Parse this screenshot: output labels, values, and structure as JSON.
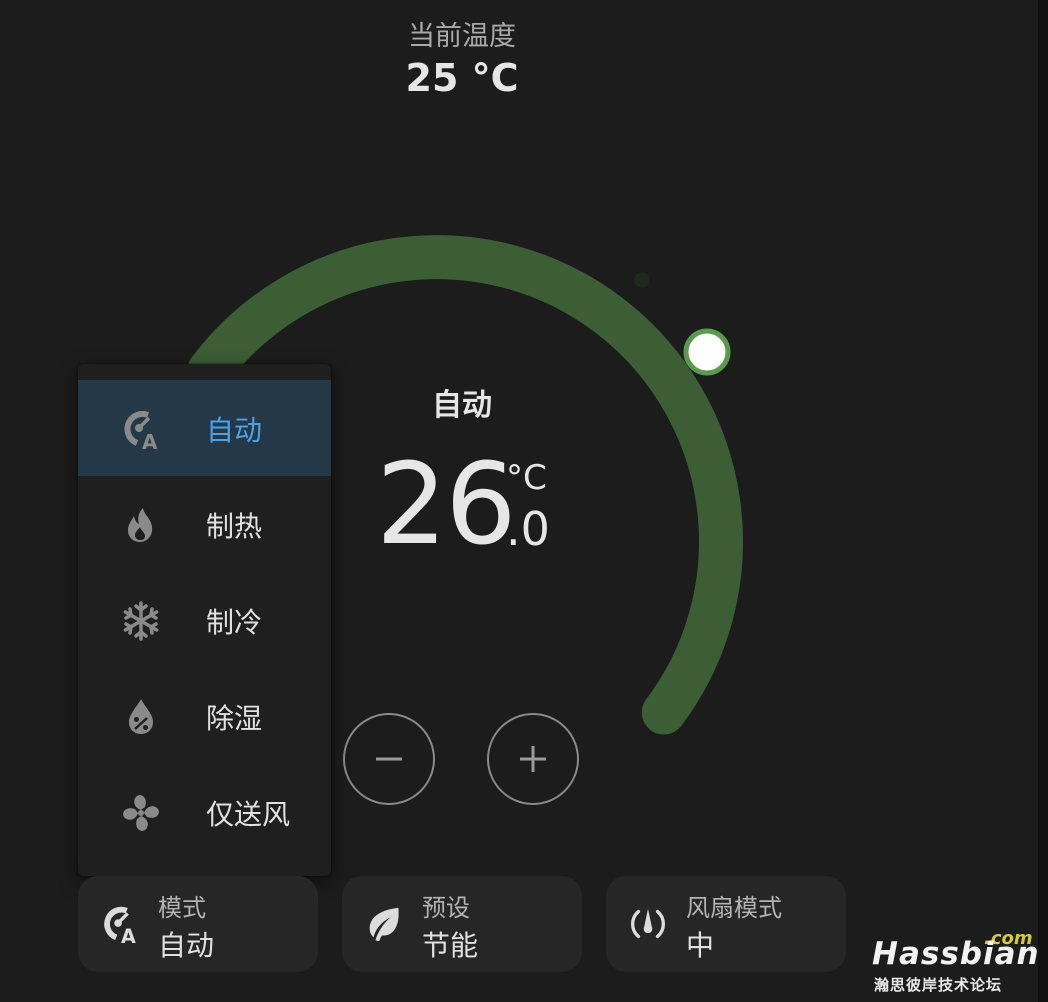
{
  "current": {
    "label": "当前温度",
    "value": "25 °C"
  },
  "dial": {
    "arc_color": "#3b5e35",
    "handle_ring_color": "#5a9a4c",
    "handle_fill_color": "#ffffff",
    "indicator_dot_color": "#1e2a1c",
    "mode_text": "自动",
    "target_integer": "26",
    "target_unit": "°C",
    "target_decimal": ".0",
    "minus_icon": "minus-icon",
    "plus_icon": "plus-icon"
  },
  "mode_menu": {
    "items": [
      {
        "label": "自动",
        "icon": "thermostat-auto-icon",
        "selected": true
      },
      {
        "label": "制热",
        "icon": "fire-icon",
        "selected": false
      },
      {
        "label": "制冷",
        "icon": "snowflake-icon",
        "selected": false
      },
      {
        "label": "除湿",
        "icon": "water-percent-icon",
        "selected": false
      },
      {
        "label": "仅送风",
        "icon": "fan-icon",
        "selected": false
      }
    ],
    "selected_color": "#4aa3e8",
    "selected_bg": "#243848"
  },
  "controls": {
    "mode": {
      "title": "模式",
      "value": "自动",
      "icon": "thermostat-auto-icon"
    },
    "preset": {
      "title": "预设",
      "value": "节能",
      "icon": "leaf-icon"
    },
    "fan": {
      "title": "风扇模式",
      "value": "中",
      "icon": "fan-speed-icon"
    }
  },
  "watermark": {
    "com": ".com",
    "brand": "Hassbian",
    "subtitle": "瀚思彼岸技术论坛"
  }
}
